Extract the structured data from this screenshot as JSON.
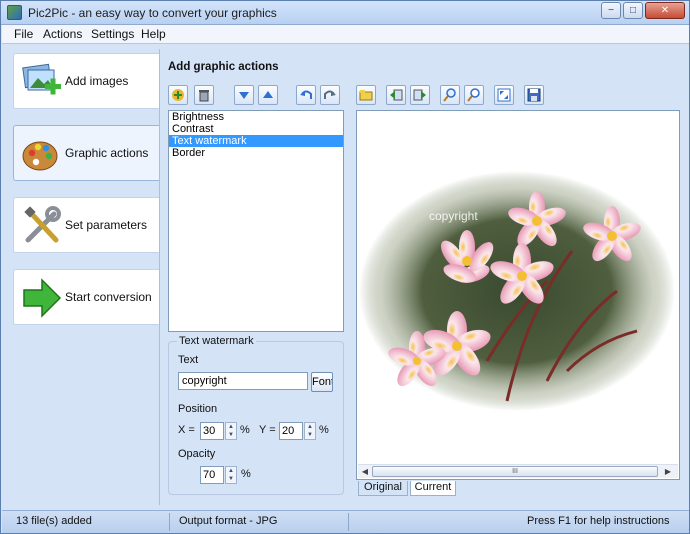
{
  "window": {
    "title": "Pic2Pic - an easy way to convert your graphics",
    "controls": {
      "minimize": "−",
      "maximize": "□",
      "close": "✕"
    }
  },
  "menu": [
    "File",
    "Actions",
    "Settings",
    "Help"
  ],
  "steps": [
    {
      "label": "Add images",
      "icon": "add-images-icon"
    },
    {
      "label": "Graphic actions",
      "icon": "palette-icon"
    },
    {
      "label": "Set parameters",
      "icon": "tools-icon"
    },
    {
      "label": "Start conversion",
      "icon": "green-arrow-icon"
    }
  ],
  "active_step": "Graphic actions",
  "panel": {
    "title": "Add graphic actions",
    "actions": [
      "Brightness",
      "Contrast",
      "Text watermark",
      "Border"
    ],
    "selected_action": "Text watermark"
  },
  "settings": {
    "group_title": "Text watermark",
    "text_label": "Text",
    "text_value": "copyright",
    "font_button": "Font",
    "position_label": "Position",
    "x_label": "X =",
    "x_value": "30",
    "y_label": "Y =",
    "y_value": "20",
    "percent": "%",
    "opacity_label": "Opacity",
    "opacity_value": "70"
  },
  "preview": {
    "watermark_text": "copyright",
    "tabs": [
      "Original",
      "Current"
    ],
    "active_tab": "Current",
    "scroll_grip": "III"
  },
  "statusbar": {
    "files": "13 file(s) added",
    "format": "Output format - JPG",
    "help": "Press F1 for help instructions"
  },
  "colors": {
    "window_bg": "#d4e3f6",
    "selection": "#3399ff",
    "titlebar": "#b8d1f1"
  }
}
